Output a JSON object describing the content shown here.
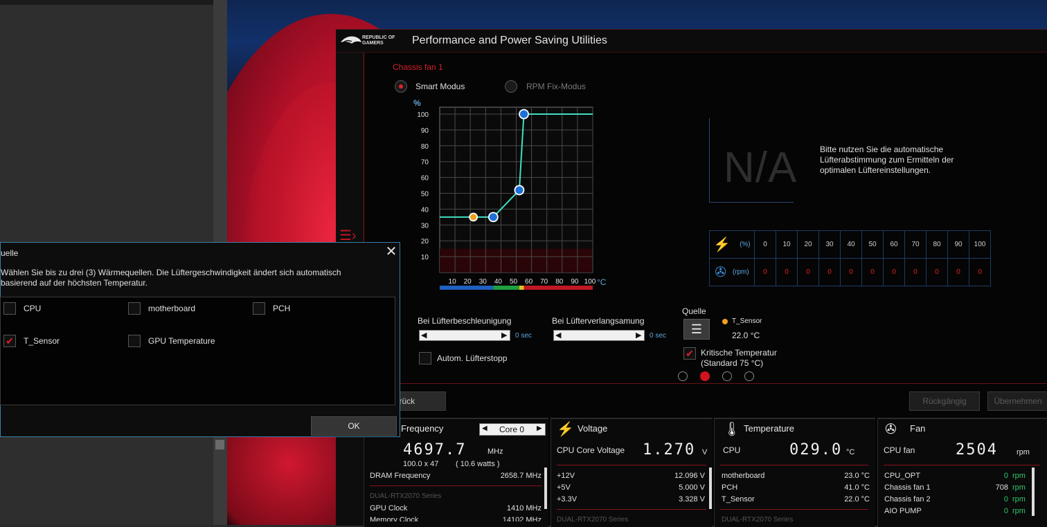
{
  "window": {
    "title": "Performance and Power Saving Utilities",
    "logo_text": "REPUBLIC OF GAMERS"
  },
  "fan": {
    "title": "Chassis fan 1",
    "mode_smart": "Smart Modus",
    "mode_rpm": "RPM Fix-Modus",
    "selected_mode": "Smart Modus"
  },
  "chart_data": {
    "type": "line",
    "ylabel": "%",
    "xlabel": "°C",
    "yticks": [
      "100",
      "90",
      "80",
      "70",
      "60",
      "50",
      "40",
      "30",
      "20",
      "10"
    ],
    "xticks": [
      "10",
      "20",
      "30",
      "40",
      "50",
      "60",
      "70",
      "80",
      "90",
      "100"
    ],
    "xlim": [
      0,
      100
    ],
    "ylim": [
      0,
      100
    ],
    "points": [
      {
        "x": 0,
        "y": 35,
        "handle": false
      },
      {
        "x": 22,
        "y": 35,
        "handle": "orange"
      },
      {
        "x": 35,
        "y": 35,
        "handle": "blue"
      },
      {
        "x": 52,
        "y": 52,
        "handle": "blue"
      },
      {
        "x": 55,
        "y": 100,
        "handle": "blue"
      },
      {
        "x": 100,
        "y": 100,
        "handle": false
      }
    ],
    "line_color": "#40e0c0",
    "temp_bar": [
      {
        "from": 0,
        "to": 35,
        "color": "#2060c0"
      },
      {
        "from": 35,
        "to": 52,
        "color": "#20a040"
      },
      {
        "from": 52,
        "to": 55,
        "color": "#e0c020"
      },
      {
        "from": 55,
        "to": 100,
        "color": "#c01822"
      }
    ]
  },
  "na": {
    "value": "N/A",
    "hint": "Bitte nutzen Sie die automatische Lüfterabstimmung zum Ermitteln der optimalen Lüftereinstellungen."
  },
  "rpm_table": {
    "percent_label": "(%)",
    "rpm_label": "(rpm)",
    "percents": [
      "0",
      "10",
      "20",
      "30",
      "40",
      "50",
      "60",
      "70",
      "80",
      "90",
      "100"
    ],
    "rpms": [
      "0",
      "0",
      "0",
      "0",
      "0",
      "0",
      "0",
      "0",
      "0",
      "0",
      "0"
    ]
  },
  "controls": {
    "accel_label": "Bei Lüfterbeschleunigung",
    "accel_value": "0 sec",
    "decel_label": "Bei Lüfterverlangsamung",
    "decel_value": "0 sec",
    "auto_stop": "Autom. Lüfterstopp",
    "source_label": "Quelle",
    "sensor_name": "T_Sensor",
    "sensor_temp": "22.0 °C",
    "critical_line1": "Kritische Temperatur",
    "critical_line2": "(Standard 75 °C)"
  },
  "actions": {
    "back": "urück",
    "undo": "Rückgängig",
    "apply": "Übernehmen"
  },
  "panels": {
    "cpu": {
      "title": "U Frequency",
      "core_select": "Core 0",
      "freq": "4697.7",
      "freq_unit": "MHz",
      "ratio": "100.0  x  47",
      "watts": "( 10.6   watts )",
      "dram_label": "DRAM Frequency",
      "dram_value": "2658.7  MHz",
      "gpu_section": "DUAL-RTX2070 Series",
      "gpu_clock_label": "GPU Clock",
      "gpu_clock_value": "1410 MHz",
      "mem_clock_label": "Memory Clock",
      "mem_clock_value": "14102 MHz"
    },
    "voltage": {
      "title": "Voltage",
      "main_label": "CPU Core Voltage",
      "main_value": "1.270",
      "main_unit": "V",
      "rows": [
        {
          "label": "+12V",
          "value": "12.096  V"
        },
        {
          "label": "+5V",
          "value": "5.000  V"
        },
        {
          "label": "+3.3V",
          "value": "3.328  V"
        }
      ],
      "gpu_section": "DUAL-RTX2070 Series"
    },
    "temperature": {
      "title": "Temperature",
      "main_label": "CPU",
      "main_value": "029.0",
      "main_unit": "°C",
      "rows": [
        {
          "label": "motherboard",
          "value": "23.0  °C"
        },
        {
          "label": "PCH",
          "value": "41.0  °C"
        },
        {
          "label": "T_Sensor",
          "value": "22.0  °C"
        }
      ],
      "gpu_section": "DUAL-RTX2070 Series"
    },
    "fan": {
      "title": "Fan",
      "main_label": "CPU fan",
      "main_value": "2504",
      "main_unit": "rpm",
      "rows": [
        {
          "label": "CPU_OPT",
          "value": "0",
          "unit": "rpm"
        },
        {
          "label": "Chassis fan 1",
          "value": "708",
          "unit": "rpm"
        },
        {
          "label": "Chassis fan 2",
          "value": "0",
          "unit": "rpm"
        },
        {
          "label": "AIO PUMP",
          "value": "0",
          "unit": "rpm"
        }
      ]
    }
  },
  "dialog": {
    "title": "uelle",
    "close": "✕",
    "desc_line1": "Wählen Sie bis zu drei (3) Wärmequellen. Die Lüftergeschwindigkeit ändert sich automatisch",
    "desc_line2": "basierend auf der höchsten Temperatur.",
    "options": [
      {
        "label": "CPU",
        "checked": false
      },
      {
        "label": "motherboard",
        "checked": false
      },
      {
        "label": "PCH",
        "checked": false
      },
      {
        "label": "T_Sensor",
        "checked": true
      },
      {
        "label": "GPU Temperature",
        "checked": false
      }
    ],
    "ok": "OK"
  },
  "colors": {
    "accent_red": "#d0141e",
    "accent_blue": "#3b7fa8",
    "curve": "#40e0c0"
  }
}
